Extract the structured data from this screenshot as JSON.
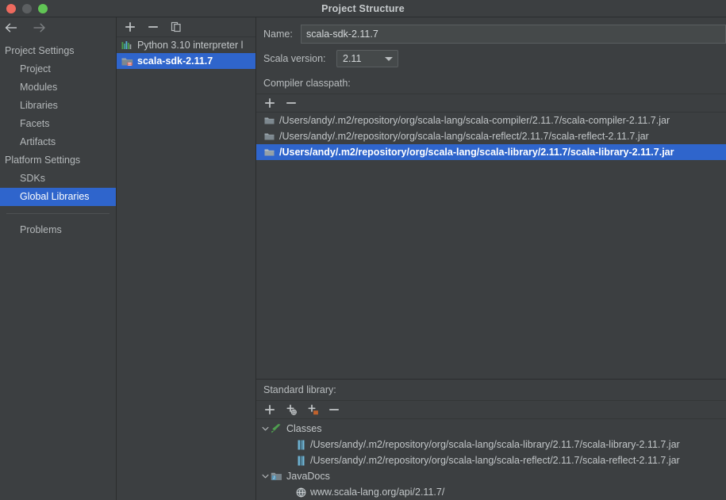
{
  "window": {
    "title": "Project Structure",
    "traffic_lights": [
      "close-red",
      "minimize-gray",
      "zoom-green"
    ]
  },
  "sidebar": {
    "nav": {
      "back_icon": "arrow-left-icon",
      "forward_icon": "arrow-right-icon"
    },
    "groups": [
      {
        "label": "Project Settings",
        "items": [
          {
            "label": "Project",
            "selected": false
          },
          {
            "label": "Modules",
            "selected": false
          },
          {
            "label": "Libraries",
            "selected": false
          },
          {
            "label": "Facets",
            "selected": false
          },
          {
            "label": "Artifacts",
            "selected": false
          }
        ]
      },
      {
        "label": "Platform Settings",
        "items": [
          {
            "label": "SDKs",
            "selected": false
          },
          {
            "label": "Global Libraries",
            "selected": true
          }
        ]
      }
    ],
    "footer_items": [
      {
        "label": "Problems",
        "selected": false
      }
    ]
  },
  "middle_panel": {
    "toolbar": [
      {
        "name": "add-button",
        "glyph": "+"
      },
      {
        "name": "remove-button",
        "glyph": "−"
      },
      {
        "name": "copy-button",
        "glyph": "copy-icon"
      }
    ],
    "items": [
      {
        "label": "Python 3.10 interpreter l",
        "icon": "python-icon",
        "selected": false
      },
      {
        "label": "scala-sdk-2.11.7",
        "icon": "scala-sdk-icon",
        "selected": true
      }
    ]
  },
  "detail": {
    "name_label": "Name:",
    "name_value": "scala-sdk-2.11.7",
    "name_placeholder": "",
    "scala_version_label": "Scala version:",
    "scala_version_value": "2.11",
    "scala_version_options": [
      "2.11"
    ],
    "compiler_classpath_label": "Compiler classpath:",
    "classpath_toolbar": [
      {
        "name": "add-classpath-button",
        "glyph": "+"
      },
      {
        "name": "remove-classpath-button",
        "glyph": "−"
      }
    ],
    "classpath_items": [
      {
        "path": "/Users/andy/.m2/repository/org/scala-lang/scala-compiler/2.11.7/scala-compiler-2.11.7.jar",
        "icon": "folder-icon",
        "selected": false
      },
      {
        "path": "/Users/andy/.m2/repository/org/scala-lang/scala-reflect/2.11.7/scala-reflect-2.11.7.jar",
        "icon": "folder-icon",
        "selected": false
      },
      {
        "path": "/Users/andy/.m2/repository/org/scala-lang/scala-library/2.11.7/scala-library-2.11.7.jar",
        "icon": "folder-icon",
        "selected": true
      }
    ],
    "standard_library_label": "Standard library:",
    "stdlib_toolbar": [
      {
        "name": "add-button",
        "glyph": "+"
      },
      {
        "name": "add-url-button",
        "glyph": "+globe"
      },
      {
        "name": "add-folder-button",
        "glyph": "+folder"
      },
      {
        "name": "remove-button",
        "glyph": "−"
      }
    ],
    "stdlib_tree": [
      {
        "label": "Classes",
        "icon": "classes-icon",
        "expanded": true,
        "children": [
          {
            "label": "/Users/andy/.m2/repository/org/scala-lang/scala-library/2.11.7/scala-library-2.11.7.jar",
            "icon": "jar-icon"
          },
          {
            "label": "/Users/andy/.m2/repository/org/scala-lang/scala-reflect/2.11.7/scala-reflect-2.11.7.jar",
            "icon": "jar-icon"
          }
        ]
      },
      {
        "label": "JavaDocs",
        "icon": "javadocs-icon",
        "expanded": true,
        "children": [
          {
            "label": "www.scala-lang.org/api/2.11.7/",
            "icon": "globe-icon"
          }
        ]
      }
    ]
  },
  "colors": {
    "background": "#3c3f41",
    "selection_blue": "#2f65cc",
    "text": "#b9bdbf",
    "text_bright": "#ffffff",
    "border": "#2b2d2e",
    "field_bg": "#45494a"
  }
}
